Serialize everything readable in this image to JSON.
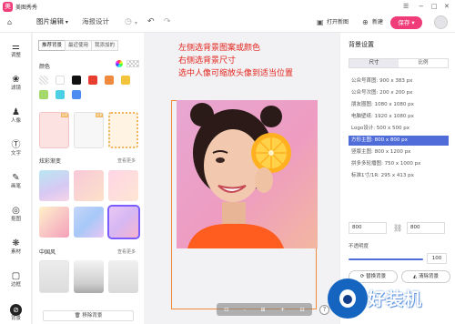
{
  "app": {
    "title": "美图秀秀"
  },
  "toolbar": {
    "menu_edit": "图片编辑",
    "menu_poster": "海报设计",
    "open": "打开新图",
    "new": "新建",
    "save": "保存"
  },
  "rail": {
    "items": [
      {
        "icon": "sliders-icon",
        "label": "调整"
      },
      {
        "icon": "filter-icon",
        "label": "滤镜"
      },
      {
        "icon": "person-icon",
        "label": "人像"
      },
      {
        "icon": "text-icon",
        "label": "文字"
      },
      {
        "icon": "brush-icon",
        "label": "画笔"
      },
      {
        "icon": "cutout-icon",
        "label": "抠图"
      },
      {
        "icon": "sticker-icon",
        "label": "素材"
      },
      {
        "icon": "frame-icon",
        "label": "边框"
      },
      {
        "icon": "background-icon",
        "label": "背景"
      }
    ]
  },
  "left": {
    "tabs": [
      "推荐背景",
      "最近使用",
      "我添加的"
    ],
    "color_label": "颜色",
    "section1": {
      "title": "炫彩渐变",
      "more": "查看更多"
    },
    "section2": {
      "title": "中国风",
      "more": "查看更多"
    },
    "remove_bg": "移除背景",
    "colors": [
      "#ffffff",
      "#9e9e9e",
      "#111111",
      "#e83e2f",
      "#f28a3e",
      "#f2c33b",
      "#a3d96a",
      "#4ed0e4",
      "#4d8df2",
      "#9b5ce8"
    ]
  },
  "canvas": {
    "annotations": [
      "左侧选背景图案或颜色",
      "右侧选背景尺寸",
      "选中人像可缩放头像到适当位置"
    ],
    "tools": [
      "⊡",
      "-",
      "⊞",
      "+",
      "⊟"
    ],
    "help": "?"
  },
  "right": {
    "title": "背景设置",
    "seg_size": "尺寸",
    "seg_ratio": "比例",
    "sizes": [
      "公众号首图: 900 x 383 px",
      "公众号次图: 200 x 200 px",
      "朋友圈图: 1080 x 1080 px",
      "电脑壁纸: 1920 x 1080 px",
      "Logo设计: 500 x 500 px",
      "方形主图: 800 x 800 px",
      "竖版主图: 800 x 1200 px",
      "拼多多轮播图: 750 x 1000 px",
      "标准1寸/1R: 295 x 413 px"
    ],
    "selected_index": 5,
    "width_value": "800",
    "height_value": "800",
    "opacity_label": "不透明度",
    "opacity_value": "100",
    "btn_replace": "替换背景",
    "btn_clear": "清除背景"
  },
  "watermark": {
    "text": "好装机"
  }
}
